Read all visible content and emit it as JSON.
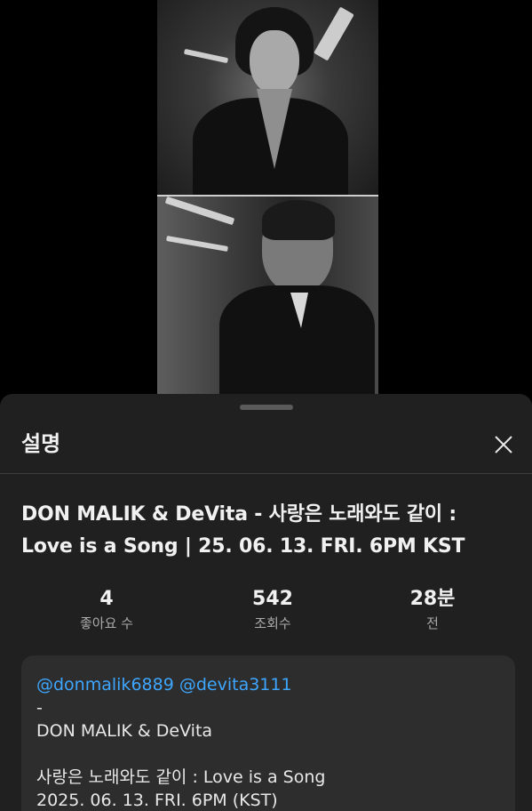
{
  "sheet": {
    "title": "설명",
    "close_icon": "close-icon"
  },
  "video": {
    "title_line1": "DON MALIK & DeVita - 사랑은 노래와도 같이 :",
    "title_line2": "Love is a Song | 25. 06. 13. FRI. 6PM KST"
  },
  "stats": {
    "likes": {
      "value": "4",
      "label": "좋아요 수"
    },
    "views": {
      "value": "542",
      "label": "조회수"
    },
    "age": {
      "value": "28분",
      "label": "전"
    }
  },
  "description": {
    "mention1": "@donmalik6889",
    "mention2": "@devita3111",
    "dash": "-",
    "artists": "DON MALIK & DeVita",
    "song": "사랑은 노래와도 같이 : Love is a Song",
    "release": "2025. 06. 13. FRI. 6PM (KST)"
  },
  "colors": {
    "sheet_bg": "#202020",
    "desc_bg": "#2d2d2d",
    "mention": "#3ea6ff",
    "text": "#f1f1f1",
    "secondary_text": "#aaaaaa"
  }
}
